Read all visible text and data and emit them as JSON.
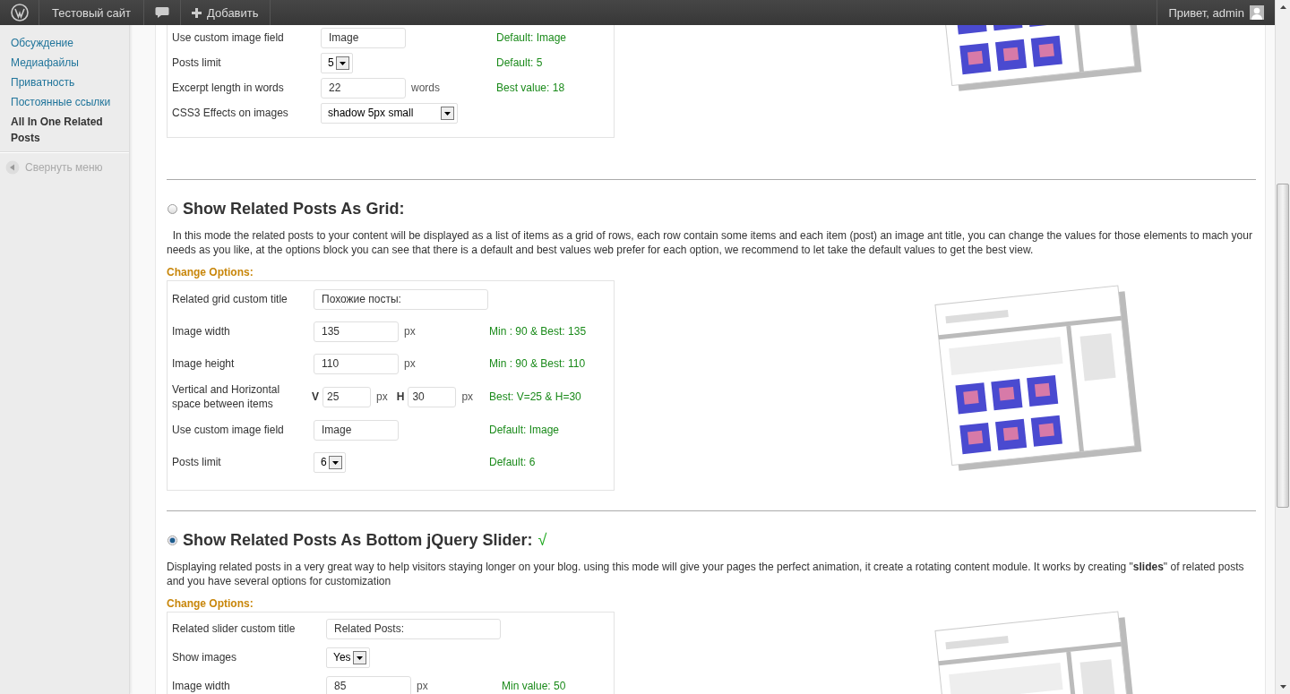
{
  "admin_bar": {
    "site_name": "Тестовый сайт",
    "add_label": "Добавить",
    "greeting": "Привет, admin"
  },
  "sidebar": {
    "items": [
      {
        "label": "Обсуждение",
        "selected": false
      },
      {
        "label": "Медиафайлы",
        "selected": false
      },
      {
        "label": "Приватность",
        "selected": false
      },
      {
        "label": "Постоянные ссылки",
        "selected": false
      },
      {
        "label": "All In One Related Posts",
        "selected": true
      }
    ],
    "collapse_label": "Свернуть меню"
  },
  "sections": [
    {
      "options": [
        {
          "label": "Use custom image field",
          "kind": "text",
          "value": "Image",
          "hint": "Default: Image"
        },
        {
          "label": "Posts limit",
          "kind": "select",
          "value": "5",
          "hint": "Default: 5"
        },
        {
          "label": "Excerpt length in words",
          "kind": "text",
          "value": "22",
          "unit": "words",
          "hint": "Best value: 18"
        },
        {
          "label": "CSS3 Effects on images",
          "kind": "select",
          "value": "shadow 5px small"
        }
      ],
      "preview": {
        "kind": "picture"
      }
    },
    {
      "title": "Show Related Posts As Grid:",
      "selected": false,
      "description": "  In this mode the related posts to your content will be displayed as a list of items as a grid of rows, each row contain some items and each item (post) an image ant title, you can change the values for those elements to mach your needs as you like, at the options block you can see that there is a default and best values web prefer for each option, we recommend to let take the default values to get the best view.",
      "options_heading": "Change Options:",
      "options": [
        {
          "label": "Related grid custom title",
          "kind": "text",
          "value": "Похожие посты:"
        },
        {
          "label": "Image width",
          "kind": "text",
          "value": "135",
          "unit": "px",
          "hint": "Min : 90 & Best: 135"
        },
        {
          "label": "Image height",
          "kind": "text",
          "value": "110",
          "unit": "px",
          "hint": "Min : 90 & Best: 110"
        },
        {
          "label": "Vertical and Horizontal space between items",
          "kind": "pair",
          "fields": [
            {
              "prefix": "V",
              "value": "25",
              "unit": "px"
            },
            {
              "prefix": "H",
              "value": "30",
              "unit": "px"
            }
          ],
          "hint": "Best: V=25 & H=30"
        },
        {
          "label": "Use custom image field",
          "kind": "text",
          "value": "Image",
          "hint": "Default: Image"
        },
        {
          "label": "Posts limit",
          "kind": "select",
          "value": "6",
          "hint": "Default: 6"
        }
      ],
      "preview": {
        "kind": "picture"
      }
    },
    {
      "title": "Show Related Posts As Bottom jQuery Slider:",
      "selected": true,
      "checkmark": "√",
      "description": "Displaying related posts in a very great way to help visitors staying longer on your blog. using this mode will give your pages the perfect animation, it create a rotating content module. It works by creating \"**slides**\" of related posts and you have several options for customization",
      "options_heading": "Change Options:",
      "options": [
        {
          "label": "Related slider custom title",
          "kind": "text",
          "value": "Related Posts:"
        },
        {
          "label": "Show images",
          "kind": "select",
          "value": "Yes"
        },
        {
          "label": "Image width",
          "kind": "text",
          "value": "85",
          "unit": "px",
          "hint": "Min value: 50"
        }
      ],
      "preview": {
        "kind": "picture"
      }
    }
  ]
}
